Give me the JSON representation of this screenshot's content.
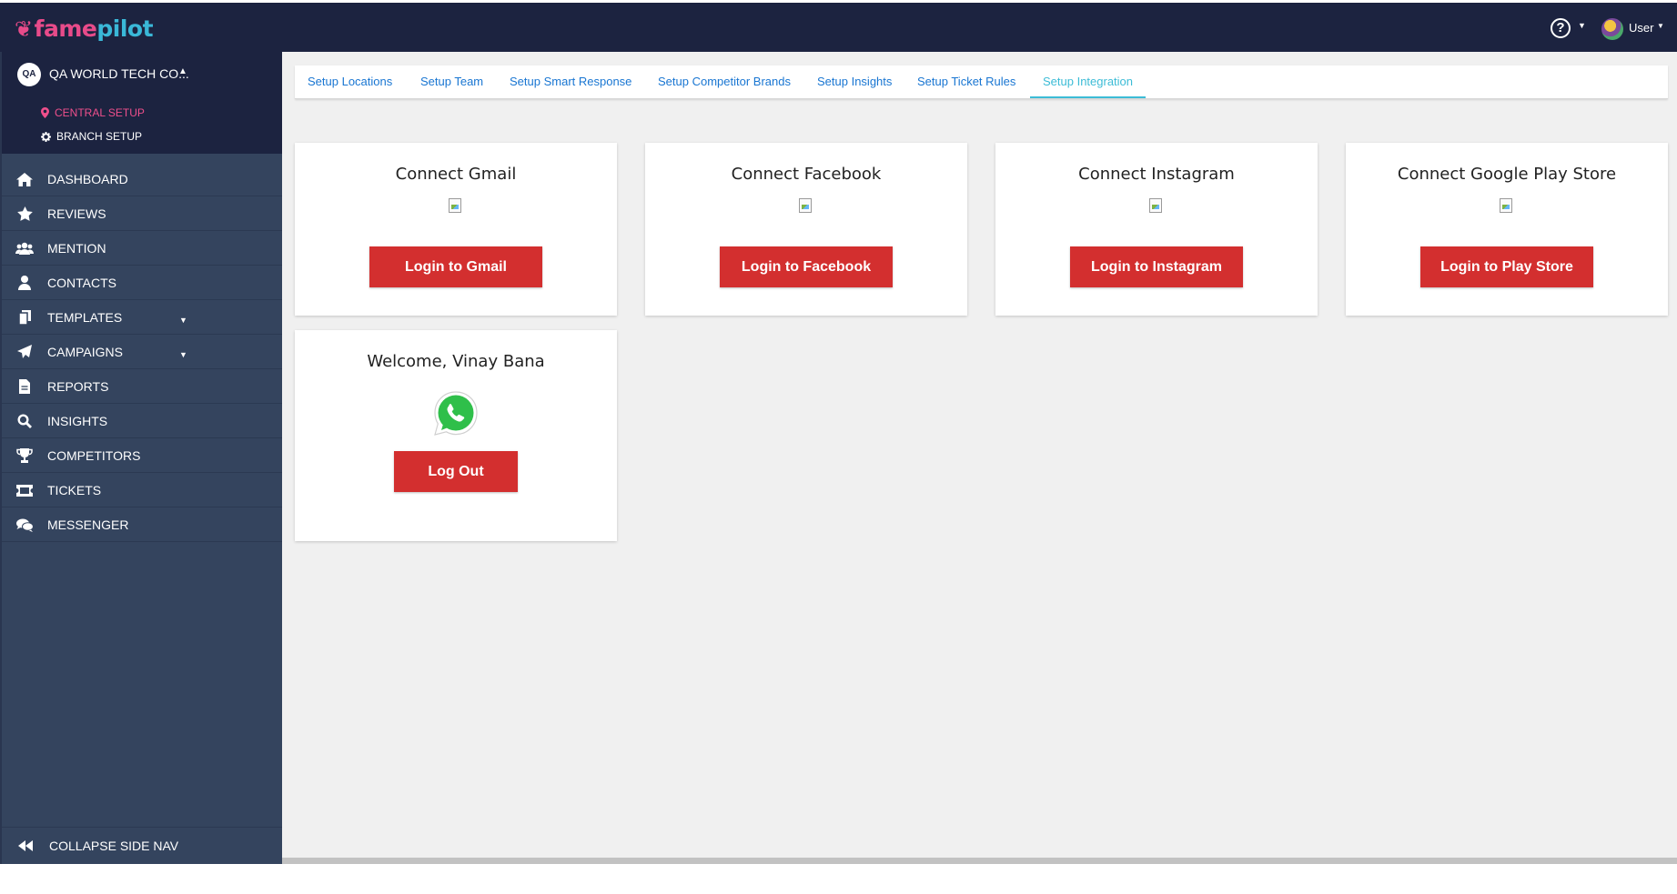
{
  "header": {
    "logo_fame": "fame",
    "logo_pilot": "pilot",
    "help_symbol": "?",
    "user_label": "User",
    "colors": {
      "bar": "#1c2340",
      "fame": "#e84b8a",
      "pilot": "#3ab8d8"
    }
  },
  "sidebar": {
    "org_badge": "QA",
    "org_name": "QA WORLD TECH CO...",
    "setup": [
      {
        "label": "CENTRAL SETUP",
        "icon": "map-pin-icon",
        "active": true
      },
      {
        "label": "BRANCH SETUP",
        "icon": "gear-icon",
        "active": false
      }
    ],
    "items": [
      {
        "label": "DASHBOARD",
        "icon": "home-icon"
      },
      {
        "label": "REVIEWS",
        "icon": "star-icon"
      },
      {
        "label": "MENTION",
        "icon": "users-icon"
      },
      {
        "label": "CONTACTS",
        "icon": "user-icon"
      },
      {
        "label": "TEMPLATES",
        "icon": "copy-icon",
        "has_dropdown": true
      },
      {
        "label": "CAMPAIGNS",
        "icon": "paper-plane-icon",
        "has_dropdown": true
      },
      {
        "label": "REPORTS",
        "icon": "file-icon"
      },
      {
        "label": "INSIGHTS",
        "icon": "search-icon"
      },
      {
        "label": "COMPETITORS",
        "icon": "trophy-icon"
      },
      {
        "label": "TICKETS",
        "icon": "ticket-icon"
      },
      {
        "label": "MESSENGER",
        "icon": "comments-icon"
      }
    ],
    "collapse_label": "COLLAPSE SIDE NAV",
    "colors": {
      "background": "#34445e",
      "active_setup": "#ef4f8c"
    }
  },
  "tabs": [
    {
      "label": "Setup Locations",
      "active": false
    },
    {
      "label": "Setup Team",
      "active": false
    },
    {
      "label": "Setup Smart Response",
      "active": false
    },
    {
      "label": "Setup Competitor Brands",
      "active": false
    },
    {
      "label": "Setup Insights",
      "active": false
    },
    {
      "label": "Setup Ticket Rules",
      "active": false
    },
    {
      "label": "Setup Integration",
      "active": true
    }
  ],
  "cards": [
    {
      "title": "Connect Gmail",
      "button": "Login to Gmail"
    },
    {
      "title": "Connect Facebook",
      "button": "Login to Facebook"
    },
    {
      "title": "Connect Instagram",
      "button": "Login to Instagram"
    },
    {
      "title": "Connect Google Play Store",
      "button": "Login to Play Store"
    }
  ],
  "whatsapp_card": {
    "title": "Welcome, Vinay Bana",
    "icon": "whatsapp-icon",
    "button": "Log Out"
  },
  "accent_colors": {
    "button": "#d32f2f",
    "tab_link": "#1976d2",
    "tab_active": "#3cbcd6"
  }
}
